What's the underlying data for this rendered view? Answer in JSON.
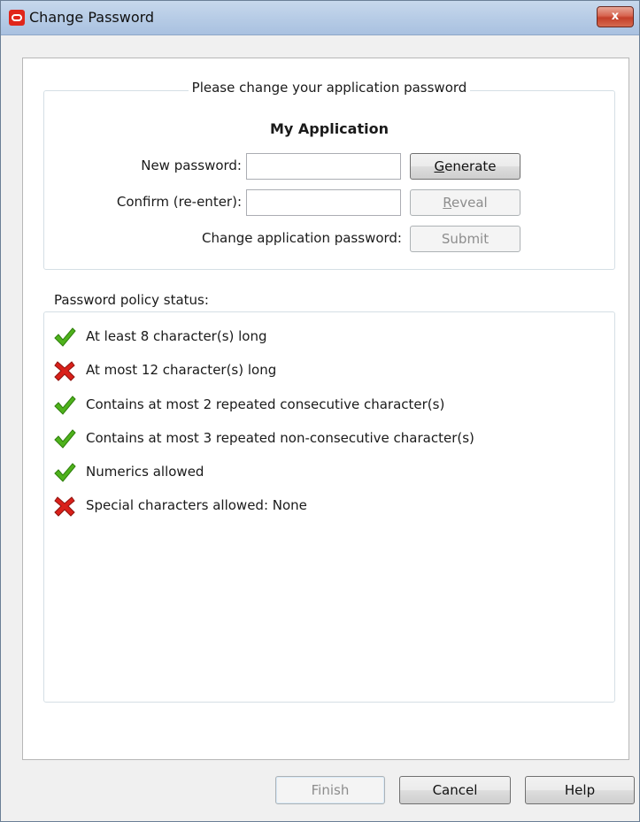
{
  "window": {
    "title": "Change Password",
    "close_label": "x",
    "app_icon": "oracle-icon"
  },
  "form": {
    "legend": "Please change your application password",
    "app_name": "My Application",
    "new_password_label": "New password:",
    "confirm_label": "Confirm (re-enter):",
    "change_label": "Change application password:",
    "new_password_value": "",
    "confirm_value": "",
    "generate_button": {
      "accel": "G",
      "rest": "enerate"
    },
    "reveal_button": {
      "accel": "R",
      "rest": "eveal"
    },
    "submit_button": "Submit"
  },
  "policy": {
    "label": "Password policy status:",
    "items": [
      {
        "status": "pass",
        "icon": "check-icon",
        "text": "At least 8 character(s) long"
      },
      {
        "status": "fail",
        "icon": "cross-icon",
        "text": "At most 12 character(s) long"
      },
      {
        "status": "pass",
        "icon": "check-icon",
        "text": "Contains at most 2 repeated consecutive character(s)"
      },
      {
        "status": "pass",
        "icon": "check-icon",
        "text": "Contains at most 3 repeated non-consecutive character(s)"
      },
      {
        "status": "pass",
        "icon": "check-icon",
        "text": "Numerics allowed"
      },
      {
        "status": "fail",
        "icon": "cross-icon",
        "text": "Special characters allowed: None"
      }
    ]
  },
  "footer": {
    "finish": "Finish",
    "cancel": "Cancel",
    "help": "Help"
  },
  "colors": {
    "pass": "#4fb21c",
    "fail": "#d9201a",
    "titlebar": "#b7cce6"
  }
}
